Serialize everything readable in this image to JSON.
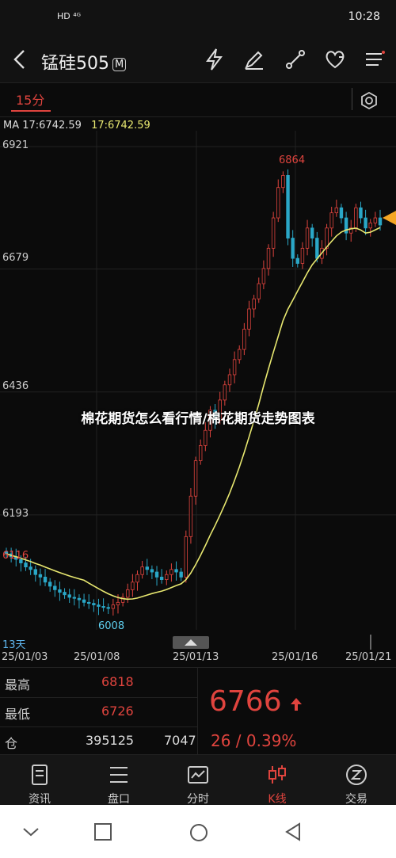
{
  "status_bar": {
    "network": "HD ⁴ᴳ",
    "time": "10:28"
  },
  "header": {
    "title": "锰硅505",
    "badge": "M"
  },
  "toolbar": {
    "period": "15分"
  },
  "ma_line": {
    "label": "MA 17:6742.59",
    "value": "17:6742.59"
  },
  "y_axis_labels": [
    "6921",
    "6679",
    "6436",
    "6193"
  ],
  "annotations": {
    "high": "6864",
    "left_value": "6116",
    "low": "6008",
    "days": "13天"
  },
  "dates": [
    "25/01/03",
    "25/01/08",
    "25/01/13",
    "25/01/16",
    "25/01/21"
  ],
  "overlay_title": "棉花期货怎么看行情/棉花期货走势图表",
  "quote": {
    "high_label": "最高",
    "high_value": "6818",
    "low_label": "最低",
    "low_value": "6726",
    "oi_label": "仓",
    "oi_value": "395125",
    "vol_value": "7047",
    "price": "6766",
    "change": "26 / 0.39%"
  },
  "nav": [
    {
      "label": "资讯",
      "icon": "news-icon"
    },
    {
      "label": "盘口",
      "icon": "orderbook-icon"
    },
    {
      "label": "分时",
      "icon": "timeshare-icon"
    },
    {
      "label": "K线",
      "icon": "candlestick-icon",
      "active": true
    },
    {
      "label": "交易",
      "icon": "trade-icon"
    }
  ],
  "colors": {
    "up": "#e0443e",
    "down": "#2aa7c7",
    "ma": "#e8e870",
    "accent": "#e0443e"
  },
  "chart_data": {
    "type": "candlestick",
    "ylim": [
      6008,
      6921
    ],
    "y_ticks": [
      6921,
      6679,
      6436,
      6193
    ],
    "x_tick_labels": [
      "25/01/03",
      "25/01/08",
      "25/01/13",
      "25/01/16",
      "25/01/21"
    ],
    "close": [
      6116,
      6110,
      6105,
      6098,
      6090,
      6085,
      6075,
      6070,
      6060,
      6052,
      6045,
      6040,
      6035,
      6030,
      6028,
      6025,
      6020,
      6018,
      6015,
      6012,
      6010,
      6008,
      6015,
      6020,
      6030,
      6045,
      6060,
      6075,
      6090,
      6085,
      6080,
      6070,
      6065,
      6075,
      6085,
      6080,
      6070,
      6150,
      6230,
      6300,
      6330,
      6360,
      6400,
      6380,
      6420,
      6450,
      6470,
      6500,
      6520,
      6560,
      6600,
      6620,
      6650,
      6680,
      6720,
      6780,
      6840,
      6864,
      6740,
      6700,
      6690,
      6720,
      6760,
      6740,
      6700,
      6720,
      6760,
      6790,
      6800,
      6780,
      6750,
      6760,
      6800,
      6780,
      6760,
      6770,
      6780,
      6766
    ],
    "ma_period": 17,
    "ma_last": 6742.59
  }
}
